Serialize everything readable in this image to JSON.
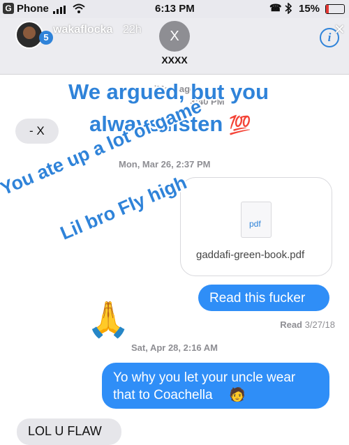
{
  "status": {
    "carrier": "Phone",
    "time": "6:13 PM",
    "battery": "15%"
  },
  "story": {
    "username": "wakaflocka",
    "age": "22h",
    "badge": "5"
  },
  "contact": {
    "initial": "X",
    "name": "XXXX"
  },
  "thread": {
    "service_label": "iMessage",
    "service_time": "3:40 PM",
    "first_msg": "- X",
    "date1_prefix": "Mon, Mar 26,",
    "date1_time": "2:37 PM",
    "attachment_ext": "pdf",
    "attachment_name": "gaddafi-green-book.pdf",
    "msg_out_1": "Read this fucker",
    "read_receipt_prefix": "Read",
    "read_receipt_date": "3/27/18",
    "date2": "Sat, Apr 28, 2:16 AM",
    "msg_out_2_line1": "Yo why you let your uncle wear",
    "msg_out_2_line2": "that to Coachella",
    "msg_in_last": "LOL U FLAW"
  },
  "overlay": {
    "line1": "We argued, but you",
    "line2": "always listen",
    "line2_emoji": "💯",
    "diag1": "You ate up a lot of game",
    "diag2": "Lil bro Fly high"
  },
  "emoji": {
    "hands": "🙏",
    "person": "🧑"
  },
  "colors": {
    "bubble_out": "#2f8ef7",
    "bubble_in": "#e6e6ea",
    "overlay_text": "#2f83d9"
  },
  "icons": [
    "signal-icon",
    "wifi-icon",
    "bluetooth-icon",
    "battery-icon",
    "info-icon",
    "document-icon"
  ]
}
